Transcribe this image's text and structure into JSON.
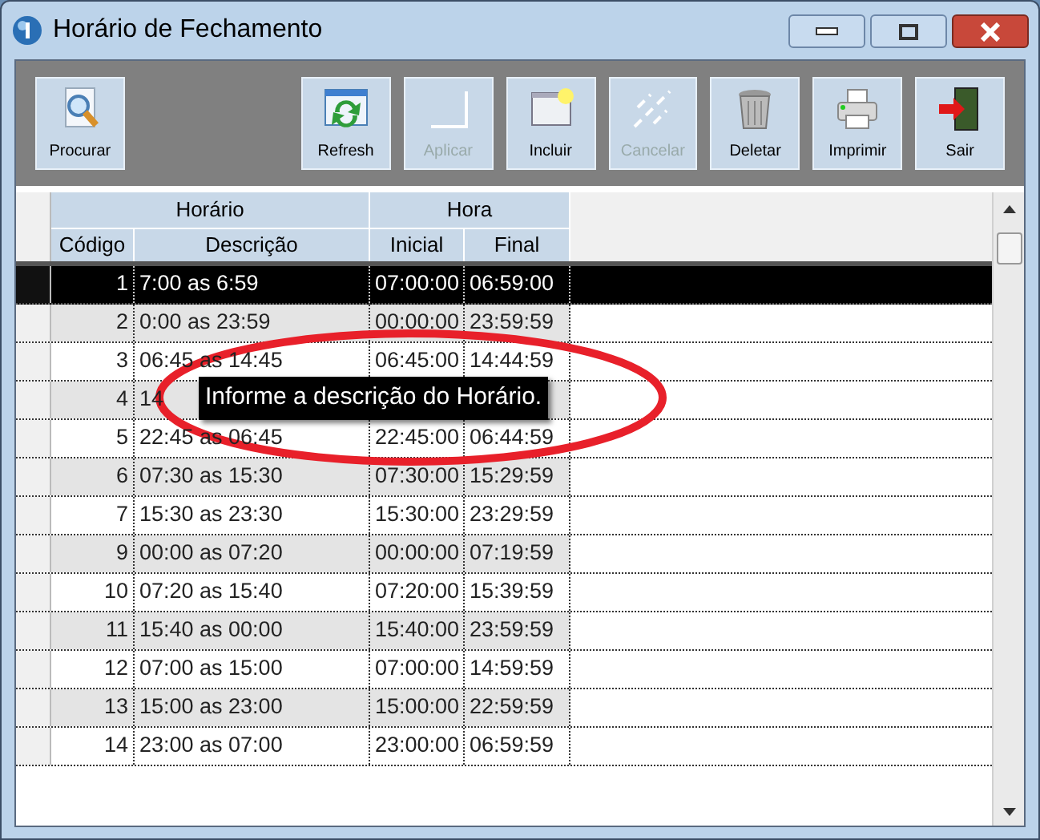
{
  "window": {
    "title": "Horário de Fechamento"
  },
  "toolbar": [
    {
      "kind": "search",
      "label": "Procurar",
      "disabled": false
    },
    {
      "kind": "refresh",
      "label": "Refresh",
      "disabled": false
    },
    {
      "kind": "apply",
      "label": "Aplicar",
      "disabled": true
    },
    {
      "kind": "new",
      "label": "Incluir",
      "disabled": false
    },
    {
      "kind": "cancel",
      "label": "Cancelar",
      "disabled": true
    },
    {
      "kind": "delete",
      "label": "Deletar",
      "disabled": false
    },
    {
      "kind": "print",
      "label": "Imprimir",
      "disabled": false
    },
    {
      "kind": "exit",
      "label": "Sair",
      "disabled": false
    }
  ],
  "table": {
    "groups": [
      {
        "label": "Horário"
      },
      {
        "label": "Hora"
      }
    ],
    "columns": [
      "Código",
      "Descrição",
      "Inicial",
      "Final"
    ],
    "rows": [
      {
        "cells": [
          "1",
          "7:00 as 6:59",
          "07:00:00",
          "06:59:00"
        ],
        "selected": true
      },
      {
        "cells": [
          "2",
          "0:00 as 23:59",
          "00:00:00",
          "23:59:59"
        ],
        "selected": false
      },
      {
        "cells": [
          "3",
          "06:45 as 14:45",
          "06:45:00",
          "14:44:59"
        ],
        "selected": false
      },
      {
        "cells": [
          "4",
          "14"
        ],
        "selected": false
      },
      {
        "cells": [
          "5",
          "22:45 as 06:45",
          "22:45:00",
          "06:44:59"
        ],
        "selected": false
      },
      {
        "cells": [
          "6",
          "07:30 as 15:30",
          "07:30:00",
          "15:29:59"
        ],
        "selected": false
      },
      {
        "cells": [
          "7",
          "15:30 as 23:30",
          "15:30:00",
          "23:29:59"
        ],
        "selected": false
      },
      {
        "cells": [
          "9",
          "00:00 as 07:20",
          "00:00:00",
          "07:19:59"
        ],
        "selected": false
      },
      {
        "cells": [
          "10",
          "07:20 as 15:40",
          "07:20:00",
          "15:39:59"
        ],
        "selected": false
      },
      {
        "cells": [
          "11",
          "15:40 as 00:00",
          "15:40:00",
          "23:59:59"
        ],
        "selected": false
      },
      {
        "cells": [
          "12",
          "07:00 as 15:00",
          "07:00:00",
          "14:59:59"
        ],
        "selected": false
      },
      {
        "cells": [
          "13",
          "15:00 as 23:00",
          "15:00:00",
          "22:59:59"
        ],
        "selected": false
      },
      {
        "cells": [
          "14",
          "23:00 as 07:00",
          "23:00:00",
          "06:59:59"
        ],
        "selected": false
      }
    ]
  },
  "tooltip": {
    "text": "Informe a descrição do Horário."
  }
}
